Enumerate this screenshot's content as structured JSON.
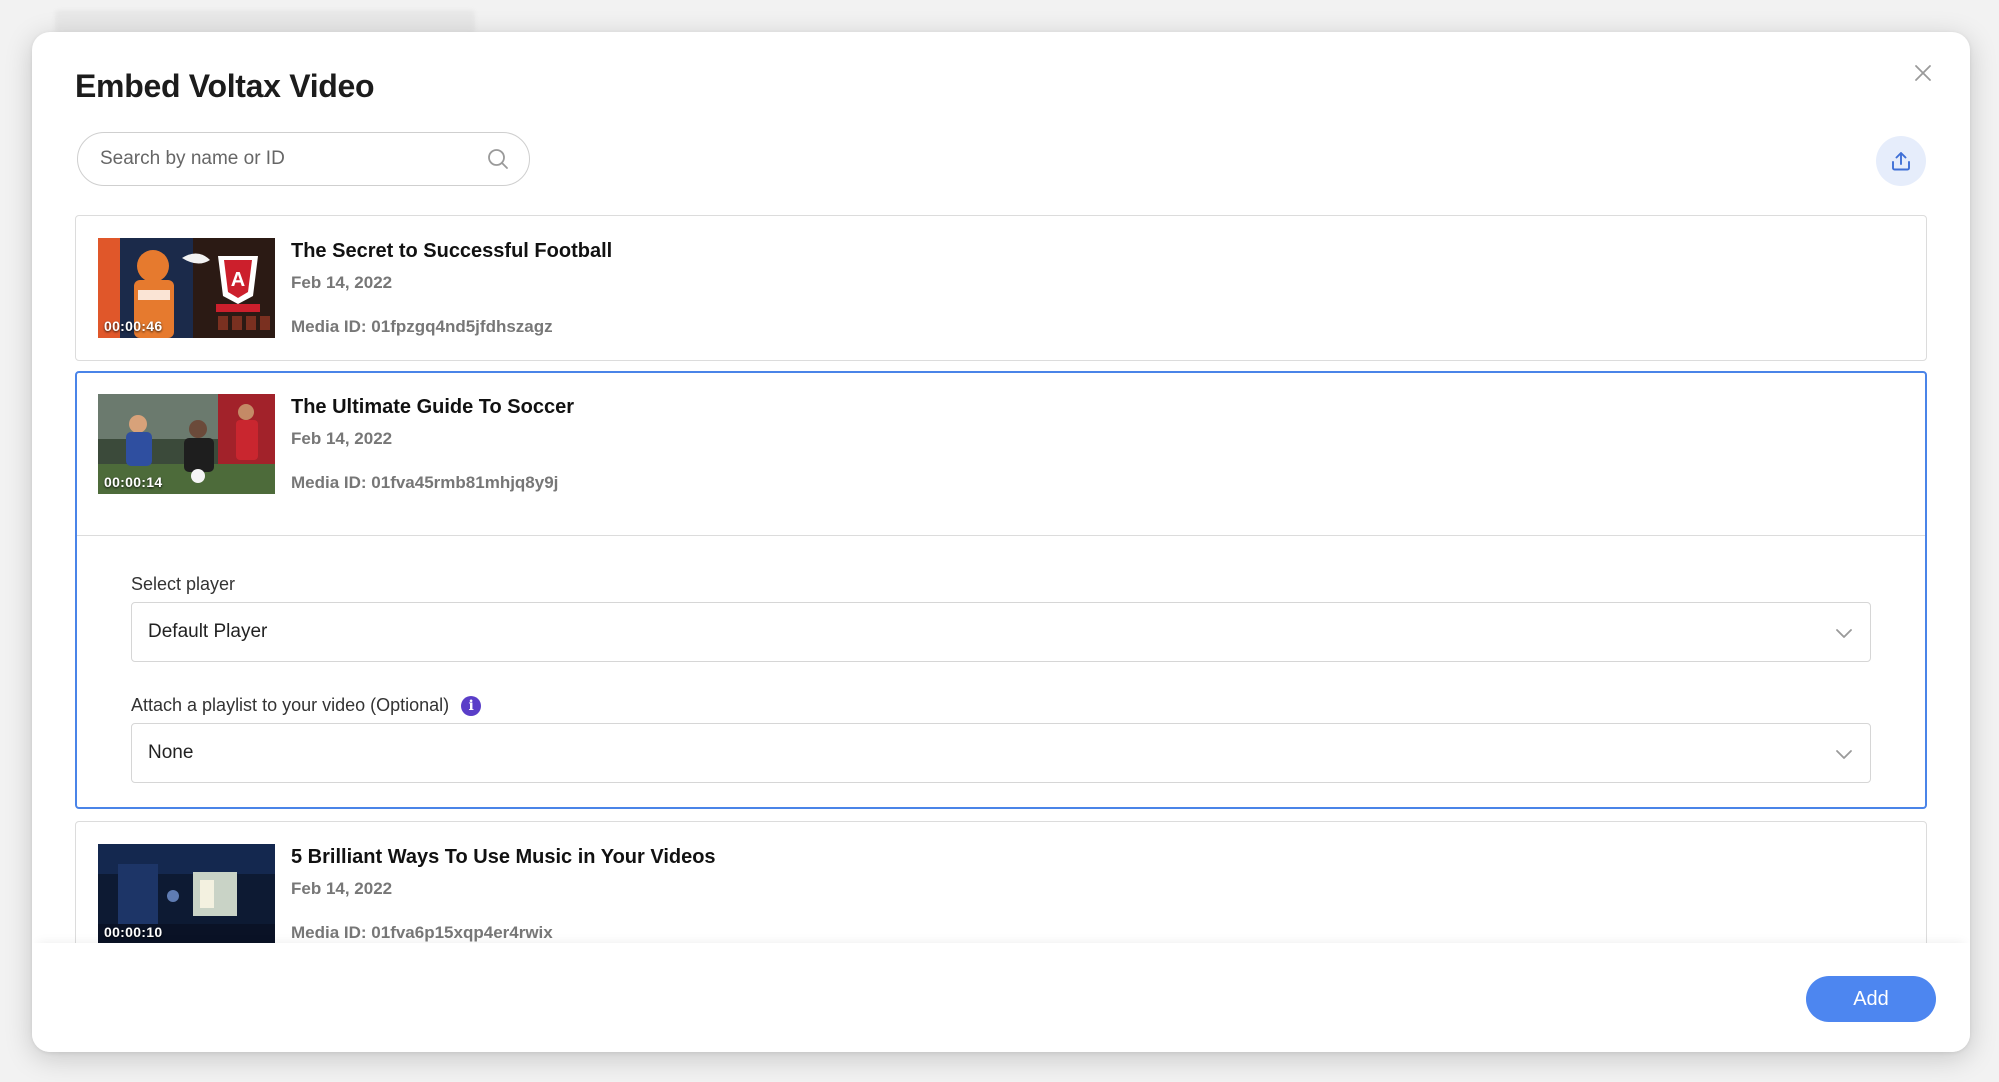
{
  "modal": {
    "title": "Embed Voltax Video"
  },
  "search": {
    "placeholder": "Search by name or ID"
  },
  "videos": [
    {
      "title": "The Secret to Successful Football",
      "date": "Feb 14, 2022",
      "media_id": "Media ID: 01fpzgq4nd5jfdhszagz",
      "duration": "00:00:46"
    },
    {
      "title": "The Ultimate Guide To Soccer",
      "date": "Feb 14, 2022",
      "media_id": "Media ID: 01fva45rmb81mhjq8y9j",
      "duration": "00:00:14"
    },
    {
      "title": "5 Brilliant Ways To Use Music in Your Videos",
      "date": "Feb 14, 2022",
      "media_id": "Media ID: 01fva6p15xqp4er4rwix",
      "duration": "00:00:10"
    }
  ],
  "options": {
    "player_label": "Select player",
    "player_value": "Default Player",
    "playlist_label": "Attach a playlist to your video (Optional)",
    "playlist_value": "None"
  },
  "footer": {
    "add_label": "Add"
  },
  "colors": {
    "accent": "#4d86f0",
    "selected_border": "#4a84e8",
    "info_icon": "#5a3ec8"
  }
}
